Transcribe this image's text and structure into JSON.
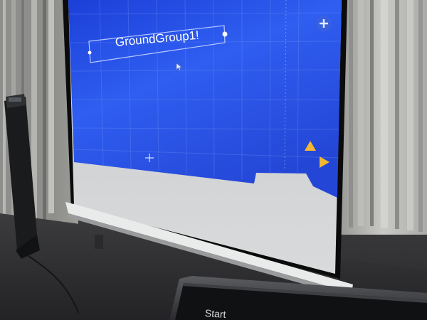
{
  "screen": {
    "label_text": "GroundGroup1!"
  },
  "laptop": {
    "start_label": "Start"
  },
  "colors": {
    "projection_blue": "#2a55e6",
    "arrow_yellow": "#f2b830",
    "screen_gray": "#d2d4d6",
    "curtain": "#a9aaa8"
  },
  "icons": [
    "plus-icon",
    "cursor-icon",
    "crosshair-icon",
    "arrow-up-icon",
    "arrow-right-icon"
  ]
}
